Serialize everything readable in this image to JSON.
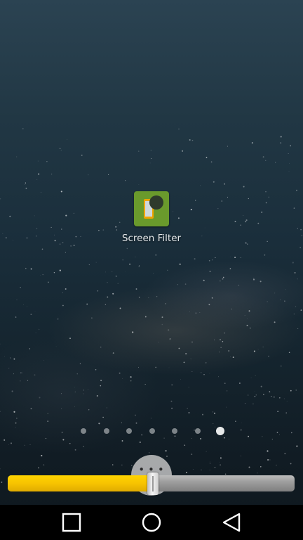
{
  "home_screen": {
    "apps": [
      {
        "label": "Screen Filter",
        "icon": "screen-filter-app-icon"
      }
    ],
    "page_indicator": {
      "page_count": 7,
      "active_page_index": 6
    }
  },
  "brightness_slider": {
    "value_fraction": 0.505,
    "fill_color": "#f7c300",
    "track_color": "#9e9e9e",
    "grip_icon": "more-dots-icon"
  },
  "navigation_bar": {
    "buttons": [
      {
        "name": "recents",
        "icon": "square-icon"
      },
      {
        "name": "home",
        "icon": "circle-icon"
      },
      {
        "name": "back",
        "icon": "triangle-back-icon"
      }
    ]
  }
}
